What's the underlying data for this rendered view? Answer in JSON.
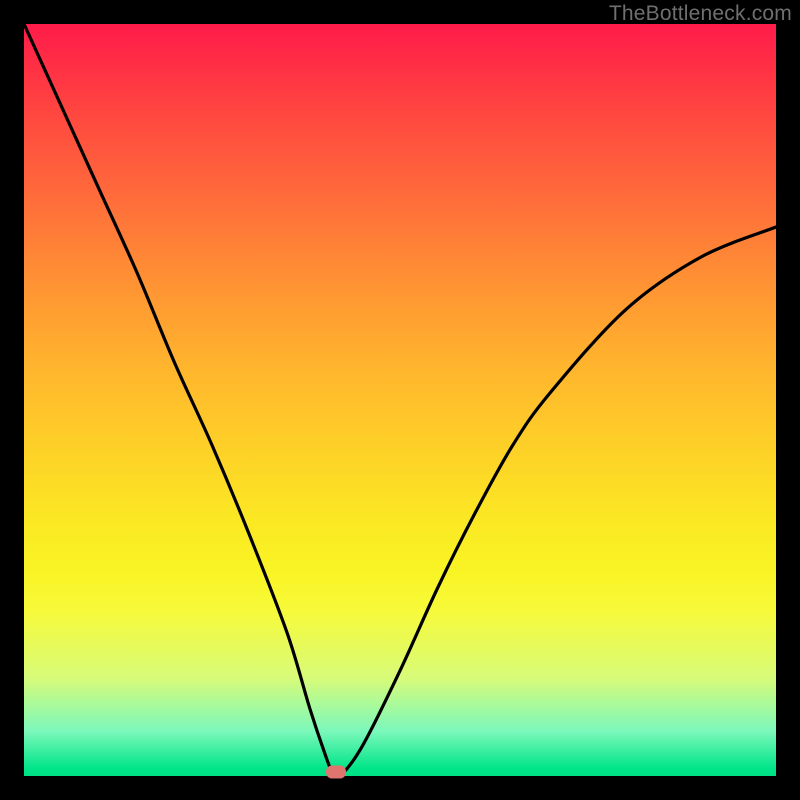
{
  "watermark": "TheBottleneck.com",
  "chart_data": {
    "type": "line",
    "title": "",
    "xlabel": "",
    "ylabel": "",
    "xlim": [
      0,
      100
    ],
    "ylim": [
      0,
      100
    ],
    "series": [
      {
        "name": "curve",
        "x": [
          0,
          5,
          10,
          15,
          20,
          25,
          30,
          35,
          38,
          40,
          41,
          42,
          45,
          50,
          55,
          60,
          65,
          70,
          80,
          90,
          100
        ],
        "y": [
          100,
          89,
          78,
          67,
          55,
          44,
          32,
          19,
          9,
          3,
          0.5,
          0,
          4,
          14,
          25,
          35,
          44,
          51,
          62,
          69,
          73
        ]
      }
    ],
    "marker": {
      "x": 41.5,
      "y": 0.5
    },
    "color_gradient": {
      "top": "#ff1b49",
      "mid": "#fde823",
      "bottom": "#00e588"
    }
  }
}
